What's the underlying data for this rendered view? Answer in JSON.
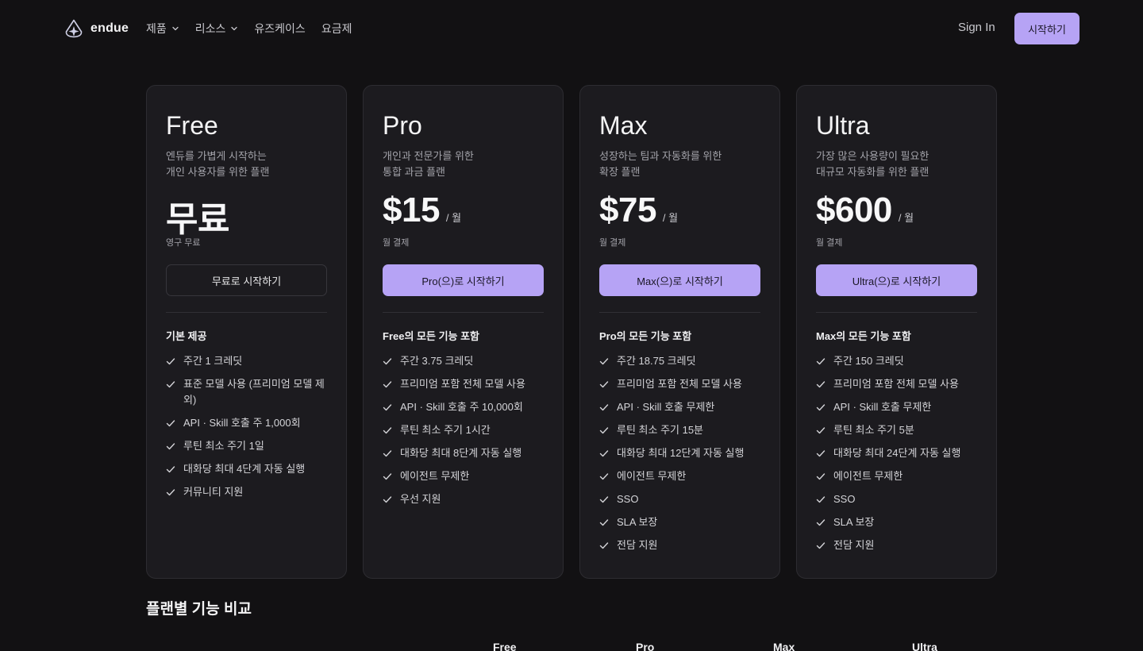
{
  "header": {
    "brand": "endue",
    "nav": [
      {
        "label": "제품",
        "has_dropdown": true
      },
      {
        "label": "리소스",
        "has_dropdown": true
      },
      {
        "label": "유즈케이스",
        "has_dropdown": false
      },
      {
        "label": "요금제",
        "has_dropdown": false
      }
    ],
    "sign_in": "Sign In",
    "cta": "시작하기"
  },
  "plans": [
    {
      "name": "Free",
      "desc_line1": "엔듀를 가볍게 시작하는",
      "desc_line2": "개인 사용자를 위한 플랜",
      "price": "무료",
      "period": "",
      "billing": "영구 무료",
      "button": "무료로 시작하기",
      "features_head": "기본 제공",
      "features": [
        "주간 1 크레딧",
        "표준 모델 사용 (프리미엄 모델 제외)",
        "API · Skill 호출 주 1,000회",
        "루틴 최소 주기 1일",
        "대화당 최대 4단계 자동 실행",
        "커뮤니티 지원"
      ]
    },
    {
      "name": "Pro",
      "desc_line1": "개인과 전문가를 위한",
      "desc_line2": "통합 과금 플랜",
      "price": "$15",
      "period": "/ 월",
      "billing": "월 결제",
      "button": "Pro(으)로 시작하기",
      "features_head": "Free의 모든 기능 포함",
      "features": [
        "주간 3.75 크레딧",
        "프리미엄 포함 전체 모델 사용",
        "API · Skill 호출 주 10,000회",
        "루틴 최소 주기 1시간",
        "대화당 최대 8단계 자동 실행",
        "에이전트 무제한",
        "우선 지원"
      ]
    },
    {
      "name": "Max",
      "desc_line1": "성장하는 팀과 자동화를 위한",
      "desc_line2": "확장 플랜",
      "price": "$75",
      "period": "/ 월",
      "billing": "월 결제",
      "button": "Max(으)로 시작하기",
      "features_head": "Pro의 모든 기능 포함",
      "features": [
        "주간 18.75 크레딧",
        "프리미엄 포함 전체 모델 사용",
        "API · Skill 호출 무제한",
        "루틴 최소 주기 15분",
        "대화당 최대 12단계 자동 실행",
        "에이전트 무제한",
        "SSO",
        "SLA 보장",
        "전담 지원"
      ]
    },
    {
      "name": "Ultra",
      "desc_line1": "가장 많은 사용량이 필요한",
      "desc_line2": "대규모 자동화를 위한 플랜",
      "price": "$600",
      "period": "/ 월",
      "billing": "월 결제",
      "button": "Ultra(으)로 시작하기",
      "features_head": "Max의 모든 기능 포함",
      "features": [
        "주간 150 크레딧",
        "프리미엄 포함 전체 모델 사용",
        "API · Skill 호출 무제한",
        "루틴 최소 주기 5분",
        "대화당 최대 24단계 자동 실행",
        "에이전트 무제한",
        "SSO",
        "SLA 보장",
        "전담 지원"
      ]
    }
  ],
  "comparison": {
    "title": "플랜별 기능 비교",
    "columns": [
      "Free",
      "Pro",
      "Max",
      "Ultra"
    ]
  },
  "colors": {
    "background": "#121113",
    "card": "#1c1b1f",
    "accent": "#b6a3f5"
  }
}
